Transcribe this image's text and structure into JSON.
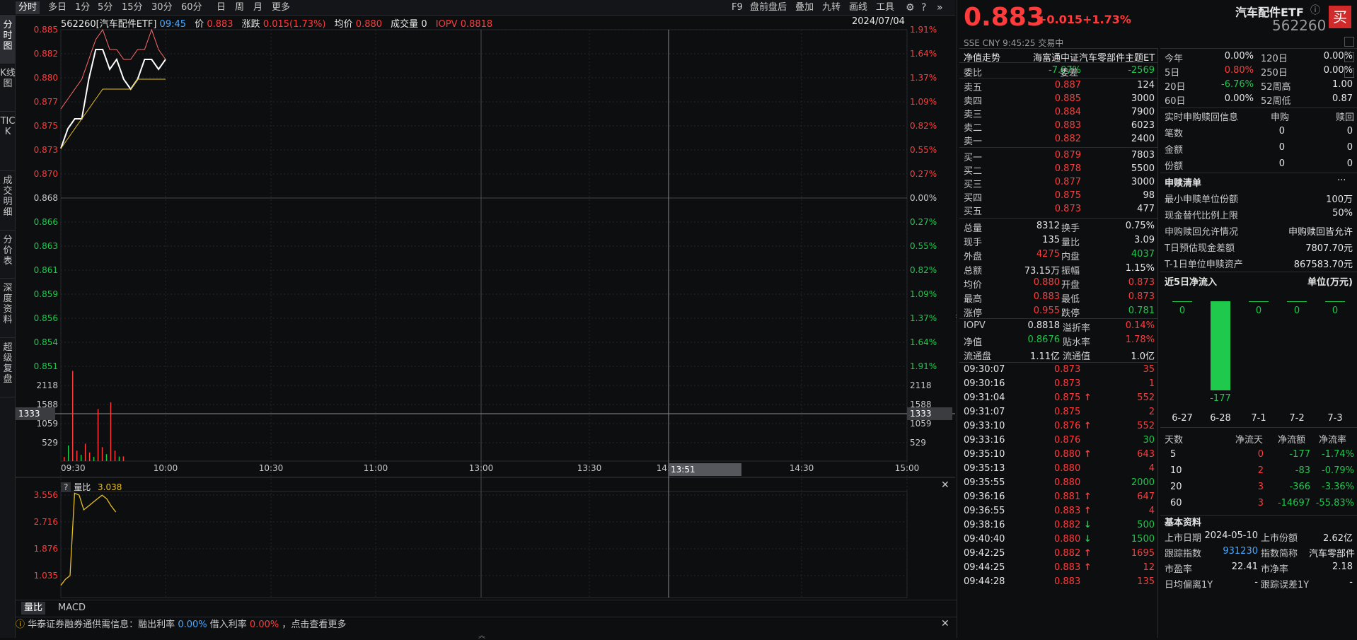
{
  "top_tabs": [
    "分时",
    "多日",
    "1分",
    "5分",
    "15分",
    "30分",
    "60分",
    "日",
    "周",
    "月",
    "更多"
  ],
  "top_tools": [
    "F9",
    "盘前盘后",
    "叠加",
    "九转",
    "画线",
    "工具"
  ],
  "left_tabs": [
    "分时图",
    "K线图",
    "TICK",
    "成交明细",
    "分价表",
    "深度资料",
    "超级复盘"
  ],
  "info_bar": {
    "code_name": "562260[汽车配件ETF]",
    "time": "09:45",
    "price_label": "价",
    "price": "0.883",
    "change_label": "涨跌",
    "change": "0.015(1.73%)",
    "avg_label": "均价",
    "avg": "0.880",
    "vol_label": "成交量",
    "vol": "0",
    "iopv_label": "IOPV",
    "iopv": "0.8818",
    "date": "2024/07/04"
  },
  "price_axis_left": [
    "0.885",
    "0.882",
    "0.880",
    "0.877",
    "0.875",
    "0.873",
    "0.870",
    "0.868",
    "0.866",
    "0.863",
    "0.861",
    "0.859",
    "0.856",
    "0.854",
    "0.851"
  ],
  "price_axis_right": [
    "1.91%",
    "1.64%",
    "1.37%",
    "1.09%",
    "0.82%",
    "0.55%",
    "0.27%",
    "0.00%",
    "0.27%",
    "0.55%",
    "0.82%",
    "1.09%",
    "1.37%",
    "1.64%",
    "1.91%"
  ],
  "vol_axis": [
    "2118",
    "1588",
    "1059",
    "529"
  ],
  "vol_cursor": "1333",
  "time_axis": [
    "09:30",
    "10:00",
    "10:30",
    "11:00",
    "13:00",
    "13:30",
    "14:00",
    "14:30",
    "15:00"
  ],
  "cursor_time": "13:51",
  "sub_panel": {
    "label": "量比",
    "value": "3.038",
    "axis": [
      "3.556",
      "2.716",
      "1.876",
      "1.035"
    ],
    "tabs": [
      "量比",
      "MACD"
    ]
  },
  "bottom_notice": {
    "text1": "华泰证券融券通供需信息：融出利率",
    "rate1": "0.00%",
    "text2": "借入利率",
    "rate2": "0.00%",
    "text3": "，点击查看更多"
  },
  "quote": {
    "price": "0.883",
    "change": "+0.015",
    "pct": "+1.73%",
    "name": "汽车配件ETF",
    "code": "562260",
    "exchange": "SSE",
    "currency": "CNY",
    "time": "9:45:25",
    "status": "交易中",
    "buy_button": "买"
  },
  "nav_trend": {
    "label": "净值走势",
    "desc": "海富通中证汽车零部件主题ET"
  },
  "weibi": {
    "label1": "委比",
    "val1": "-7.07%",
    "label2": "委差",
    "val2": "-2569"
  },
  "asks": [
    {
      "l": "卖五",
      "p": "0.887",
      "v": "124"
    },
    {
      "l": "卖四",
      "p": "0.885",
      "v": "3000"
    },
    {
      "l": "卖三",
      "p": "0.884",
      "v": "7900"
    },
    {
      "l": "卖二",
      "p": "0.883",
      "v": "6023"
    },
    {
      "l": "卖一",
      "p": "0.882",
      "v": "2400"
    }
  ],
  "bids": [
    {
      "l": "买一",
      "p": "0.879",
      "v": "7803"
    },
    {
      "l": "买二",
      "p": "0.878",
      "v": "5500"
    },
    {
      "l": "买三",
      "p": "0.877",
      "v": "3000"
    },
    {
      "l": "买四",
      "p": "0.875",
      "v": "98"
    },
    {
      "l": "买五",
      "p": "0.873",
      "v": "477"
    }
  ],
  "stats": [
    [
      "总量",
      "8312",
      "换手",
      "0.75%"
    ],
    [
      "现手",
      "135",
      "量比",
      "3.09"
    ],
    [
      "外盘",
      "4275",
      "内盘",
      "4037"
    ],
    [
      "总额",
      "73.15万",
      "振幅",
      "1.15%"
    ],
    [
      "均价",
      "0.880",
      "开盘",
      "0.873"
    ],
    [
      "最高",
      "0.883",
      "最低",
      "0.873"
    ],
    [
      "涨停",
      "0.955",
      "跌停",
      "0.781"
    ]
  ],
  "iopv_stats": [
    [
      "IOPV",
      "0.8818",
      "溢折率",
      "0.14%"
    ],
    [
      "净值",
      "0.8676",
      "贴水率",
      "1.78%"
    ],
    [
      "流通盘",
      "1.11亿",
      "流通值",
      "1.0亿"
    ]
  ],
  "ticks": [
    [
      "09:30:07",
      "0.873",
      "",
      "35"
    ],
    [
      "09:30:16",
      "0.873",
      "",
      "1"
    ],
    [
      "09:31:04",
      "0.875",
      "up",
      "552"
    ],
    [
      "09:31:07",
      "0.875",
      "",
      "2"
    ],
    [
      "09:33:10",
      "0.876",
      "up",
      "552"
    ],
    [
      "09:33:16",
      "0.876",
      "",
      "30"
    ],
    [
      "09:35:10",
      "0.880",
      "up",
      "643"
    ],
    [
      "09:35:13",
      "0.880",
      "",
      "4"
    ],
    [
      "09:35:55",
      "0.880",
      "",
      "2000"
    ],
    [
      "09:36:16",
      "0.881",
      "up",
      "647"
    ],
    [
      "09:36:55",
      "0.883",
      "up",
      "4"
    ],
    [
      "09:38:16",
      "0.882",
      "down",
      "500"
    ],
    [
      "09:40:40",
      "0.880",
      "down",
      "1500"
    ],
    [
      "09:42:25",
      "0.882",
      "up",
      "1695"
    ],
    [
      "09:44:25",
      "0.883",
      "up",
      "12"
    ],
    [
      "09:44:28",
      "0.883",
      "",
      "135"
    ]
  ],
  "perf": [
    [
      "今年",
      "0.00%",
      "120日",
      "0.00%"
    ],
    [
      "5日",
      "0.80%",
      "250日",
      "0.00%"
    ],
    [
      "20日",
      "-6.76%",
      "52周高",
      "1.00"
    ],
    [
      "60日",
      "0.00%",
      "52周低",
      "0.87"
    ]
  ],
  "redemption": {
    "title": "实时申购赎回信息",
    "col1": "申购",
    "col2": "赎回",
    "rows": [
      [
        "笔数",
        "0",
        "0"
      ],
      [
        "金额",
        "0",
        "0"
      ],
      [
        "份额",
        "0",
        "0"
      ]
    ]
  },
  "creation_list": {
    "title": "申赎清单",
    "more": "···",
    "rows": [
      [
        "最小申赎单位份额",
        "100万"
      ],
      [
        "现金替代比例上限",
        "50%"
      ],
      [
        "申购赎回允许情况",
        "申购赎回皆允许"
      ],
      [
        "T日预估现金差额",
        "7807.70元"
      ],
      [
        "T-1日单位申赎资产",
        "867583.70元"
      ]
    ]
  },
  "netflow5": {
    "title": "近5日净流入",
    "unit": "单位(万元)",
    "dates": [
      "6-27",
      "6-28",
      "7-1",
      "7-2",
      "7-3"
    ],
    "values": [
      0,
      -177,
      0,
      0,
      0
    ],
    "labels": [
      "0",
      "-177",
      "0",
      "0",
      "0"
    ]
  },
  "flow_table": {
    "headers": [
      "天数",
      "净流天",
      "净流额",
      "净流率"
    ],
    "rows": [
      [
        "5",
        "0",
        "-177",
        "-1.74%"
      ],
      [
        "10",
        "2",
        "-83",
        "-0.79%"
      ],
      [
        "20",
        "3",
        "-366",
        "-3.36%"
      ],
      [
        "60",
        "3",
        "-14697",
        "-55.83%"
      ]
    ]
  },
  "basic": {
    "title": "基本资料",
    "rows": [
      [
        "上市日期",
        "2024-05-10",
        "上市份额",
        "2.62亿"
      ],
      [
        "跟踪指数",
        "931230",
        "指数简称",
        "汽车零部件"
      ],
      [
        "市盈率",
        "22.41",
        "市净率",
        "2.18"
      ],
      [
        "日均偏离1Y",
        "-",
        "跟踪误差1Y",
        "-"
      ]
    ]
  },
  "chart_data": {
    "type": "line",
    "title": "562260[汽车配件ETF]",
    "xlabel": "",
    "ylabel": "",
    "ylim": [
      0.851,
      0.885
    ],
    "price_series": [
      {
        "name": "价",
        "x": [
          "09:30",
          "09:31",
          "09:32",
          "09:33",
          "09:34",
          "09:35",
          "09:36",
          "09:37",
          "09:38",
          "09:39",
          "09:40",
          "09:41",
          "09:42",
          "09:43",
          "09:44",
          "09:45"
        ],
        "values": [
          0.873,
          0.875,
          0.876,
          0.876,
          0.88,
          0.883,
          0.883,
          0.881,
          0.882,
          0.88,
          0.879,
          0.88,
          0.882,
          0.882,
          0.881,
          0.882
        ]
      },
      {
        "name": "均价",
        "x": [
          "09:30",
          "09:31",
          "09:32",
          "09:33",
          "09:34",
          "09:35",
          "09:36",
          "09:37",
          "09:38",
          "09:39",
          "09:40",
          "09:41",
          "09:42",
          "09:43",
          "09:44",
          "09:45"
        ],
        "values": [
          0.873,
          0.874,
          0.875,
          0.876,
          0.877,
          0.878,
          0.879,
          0.879,
          0.879,
          0.879,
          0.879,
          0.88,
          0.88,
          0.88,
          0.88,
          0.88
        ]
      },
      {
        "name": "IOPV",
        "x": [
          "09:30",
          "09:31",
          "09:32",
          "09:33",
          "09:34",
          "09:35",
          "09:36",
          "09:37",
          "09:38",
          "09:39",
          "09:40",
          "09:41",
          "09:42",
          "09:43",
          "09:44",
          "09:45"
        ],
        "values": [
          0.877,
          0.878,
          0.879,
          0.88,
          0.882,
          0.884,
          0.885,
          0.883,
          0.883,
          0.882,
          0.882,
          0.883,
          0.883,
          0.885,
          0.883,
          0.882
        ]
      }
    ],
    "volume": [
      120,
      450,
      2600,
      300,
      180,
      500,
      250,
      120,
      1500,
      400,
      200,
      1695,
      300,
      130,
      135
    ],
    "volume_ylim": [
      0,
      2650
    ],
    "ratio_series": [
      1.035,
      1.2,
      1.3,
      3.556,
      3.5,
      3.1,
      3.2,
      3.3,
      3.4,
      3.5,
      3.4,
      3.2,
      3.038
    ],
    "ratio_ylim": [
      0.7,
      3.6
    ]
  },
  "colors": {
    "price": "#ffffff",
    "avg": "#e8c020",
    "iopv": "#ff6b6b",
    "up": "#ff3b3b",
    "down": "#1ec94c",
    "grid": "#2a2c30"
  }
}
